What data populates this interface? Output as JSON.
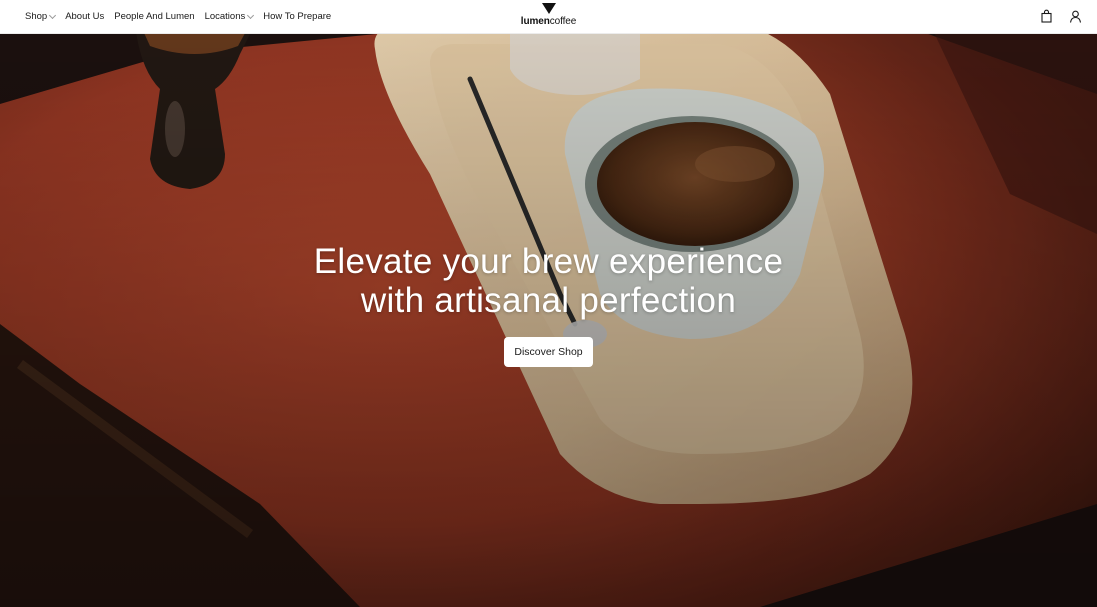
{
  "nav": {
    "items": [
      {
        "label": "Shop",
        "dropdown": true
      },
      {
        "label": "About Us",
        "dropdown": false
      },
      {
        "label": "People And Lumen",
        "dropdown": false
      },
      {
        "label": "Locations",
        "dropdown": true
      },
      {
        "label": "How To Prepare",
        "dropdown": false
      }
    ]
  },
  "brand": {
    "name_bold": "lumen",
    "name_light": "coffee"
  },
  "header_icons": [
    "shopping-bag-icon",
    "user-account-icon"
  ],
  "hero": {
    "title_line1": "Elevate your brew experience",
    "title_line2": "with artisanal perfection",
    "cta_label": "Discover Shop",
    "image_description_colors": {
      "cloth": "#a83e28",
      "wood": "#e3c49d",
      "dark": "#1e1210"
    }
  }
}
